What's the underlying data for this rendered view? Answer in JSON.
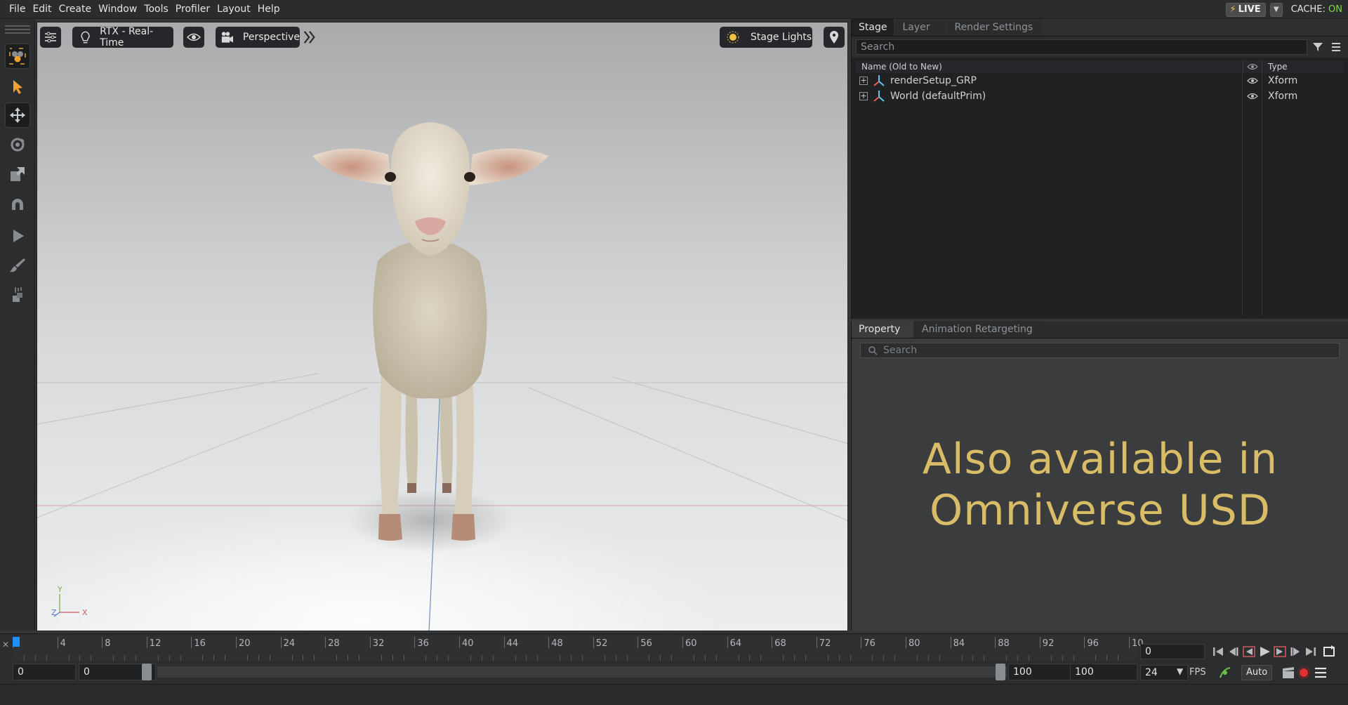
{
  "menu": [
    "File",
    "Edit",
    "Create",
    "Window",
    "Tools",
    "Profiler",
    "Layout",
    "Help"
  ],
  "status": {
    "live_label": "LIVE",
    "cache_label": "CACHE:",
    "cache_value": "ON"
  },
  "viewport": {
    "renderer_label": "RTX - Real-Time",
    "camera_label": "Perspective",
    "lights_label": "Stage Lights",
    "axis_y": "Y",
    "axis_x": "X",
    "axis_z": "Z"
  },
  "stage": {
    "tabs": [
      "Stage",
      "Layer",
      "Render Settings"
    ],
    "active_tab": "Stage",
    "search_placeholder": "Search",
    "columns": {
      "name": "Name (Old to New)",
      "type": "Type"
    },
    "rows": [
      {
        "name": "renderSetup_GRP",
        "type": "Xform"
      },
      {
        "name": "World (defaultPrim)",
        "type": "Xform"
      }
    ]
  },
  "property": {
    "tabs": [
      "Property",
      "Animation Retargeting"
    ],
    "active_tab": "Property",
    "search_placeholder": "Search",
    "promo_line1": "Also available in",
    "promo_line2": "Omniverse USD"
  },
  "timeline": {
    "ticks": [
      "0",
      "4",
      "8",
      "12",
      "16",
      "20",
      "24",
      "28",
      "32",
      "36",
      "40",
      "44",
      "48",
      "52",
      "56",
      "60",
      "64",
      "68",
      "72",
      "76",
      "80",
      "84",
      "88",
      "92",
      "96",
      "10"
    ],
    "current_frame": "0",
    "start_frame": "0",
    "range_start": "0",
    "range_end": "100",
    "end_frame": "100",
    "fps_value": "24",
    "fps_label": "FPS",
    "auto_label": "Auto"
  },
  "colors": {
    "accent": "#1e90ff",
    "promo_text": "#d8bc66",
    "live_on": "#7ddc4a",
    "tool_orange": "#f0a030"
  }
}
